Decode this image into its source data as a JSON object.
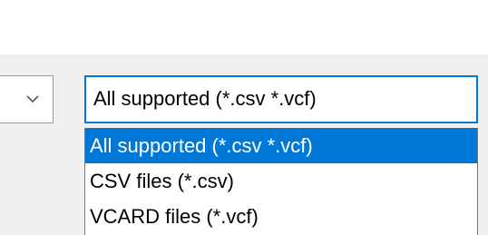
{
  "file_type_filter": {
    "selected_value": "All supported (*.csv *.vcf)",
    "options": [
      "All supported (*.csv *.vcf)",
      "CSV files (*.csv)",
      "VCARD files (*.vcf)"
    ],
    "highlighted_option": "All supported (*.csv *.vcf)"
  },
  "left_combo": {
    "icon": "chevron-down-icon"
  },
  "colors": {
    "accent": "#0078d7",
    "dialog_background": "#f0f0f0"
  }
}
